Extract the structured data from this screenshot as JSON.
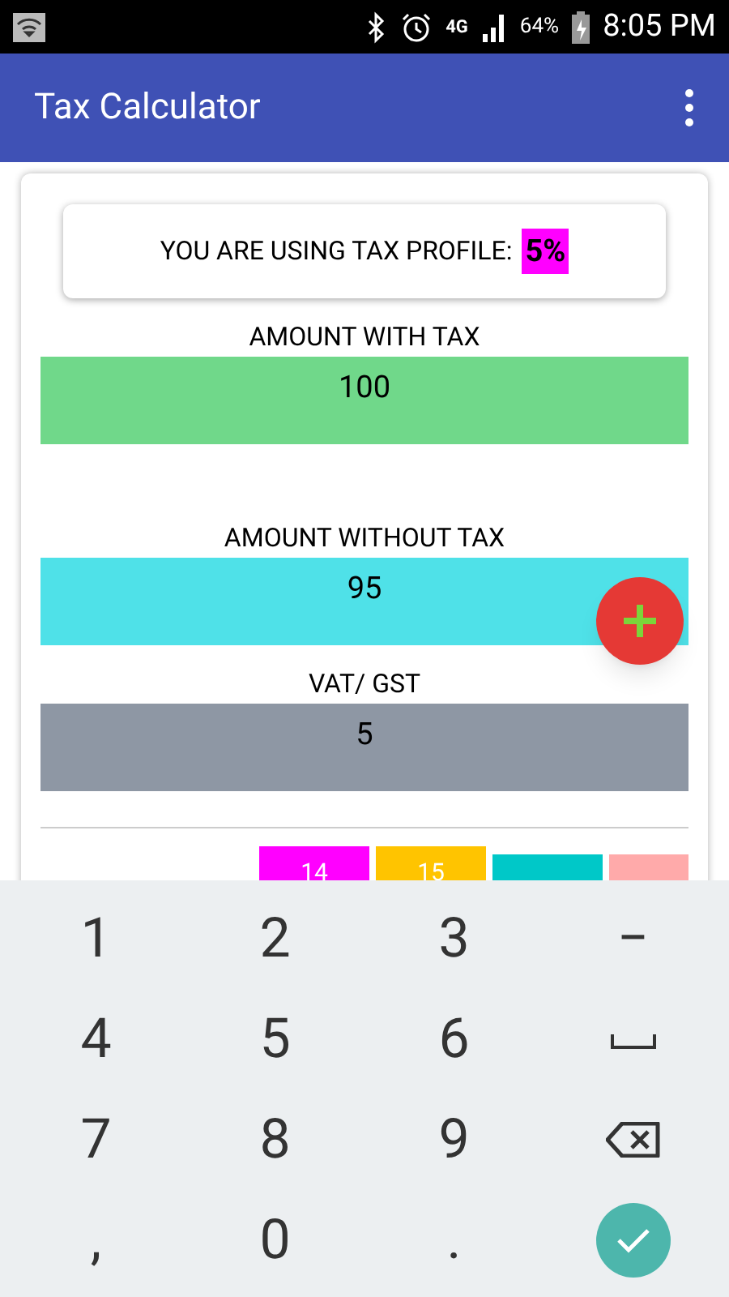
{
  "status_bar": {
    "network": "4G",
    "battery": "64%",
    "time": "8:05 PM"
  },
  "app_bar": {
    "title": "Tax Calculator"
  },
  "profile": {
    "label": "YOU ARE USING TAX PROFILE:",
    "value": "5%",
    "color": "#ff00ff"
  },
  "fields": [
    {
      "label": "AMOUNT WITH TAX",
      "value": "100",
      "color": "#70d88a"
    },
    {
      "label": "AMOUNT WITHOUT TAX",
      "value": "95",
      "color": "#4fe1e8"
    },
    {
      "label": "VAT/ GST",
      "value": "5",
      "color": "#8e97a4"
    }
  ],
  "profiles": [
    {
      "label": "14",
      "color": "#ff00ff"
    },
    {
      "label": "15",
      "color": "#ffc400"
    },
    {
      "color": "#00c8c8"
    },
    {
      "color": "#ffaaaa"
    }
  ],
  "keyboard": {
    "rows": [
      [
        {
          "kind": "key",
          "label": "1"
        },
        {
          "kind": "key",
          "label": "2"
        },
        {
          "kind": "key",
          "label": "3"
        },
        {
          "kind": "key",
          "label": "−"
        }
      ],
      [
        {
          "kind": "key",
          "label": "4"
        },
        {
          "kind": "key",
          "label": "5"
        },
        {
          "kind": "key",
          "label": "6"
        },
        {
          "kind": "space"
        }
      ],
      [
        {
          "kind": "key",
          "label": "7"
        },
        {
          "kind": "key",
          "label": "8"
        },
        {
          "kind": "key",
          "label": "9"
        },
        {
          "kind": "backspace"
        }
      ],
      [
        {
          "kind": "key",
          "label": ","
        },
        {
          "kind": "key",
          "label": "0"
        },
        {
          "kind": "key",
          "label": "."
        },
        {
          "kind": "done"
        }
      ]
    ]
  }
}
